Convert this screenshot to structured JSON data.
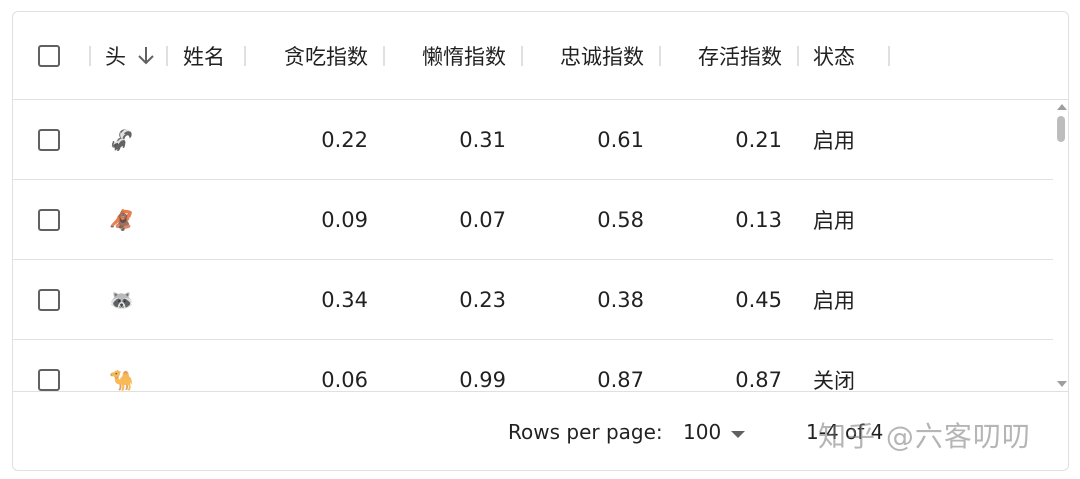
{
  "columns": {
    "head": "头",
    "name": "姓名",
    "gluttony": "贪吃指数",
    "laziness": "懒惰指数",
    "loyalty": "忠诚指数",
    "survival": "存活指数",
    "status": "状态"
  },
  "rows": [
    {
      "avatar": "🦨",
      "gluttony": "0.22",
      "laziness": "0.31",
      "loyalty": "0.61",
      "survival": "0.21",
      "status": "启用"
    },
    {
      "avatar": "🦧",
      "gluttony": "0.09",
      "laziness": "0.07",
      "loyalty": "0.58",
      "survival": "0.13",
      "status": "启用"
    },
    {
      "avatar": "🦝",
      "gluttony": "0.34",
      "laziness": "0.23",
      "loyalty": "0.38",
      "survival": "0.45",
      "status": "启用"
    },
    {
      "avatar": "🐪",
      "gluttony": "0.06",
      "laziness": "0.99",
      "loyalty": "0.87",
      "survival": "0.87",
      "status": "关闭"
    }
  ],
  "footer": {
    "rows_per_page_label": "Rows per page:",
    "rows_per_page_value": "100",
    "range": "1-4 of 4"
  },
  "watermark": "知乎 @六客叨叨"
}
